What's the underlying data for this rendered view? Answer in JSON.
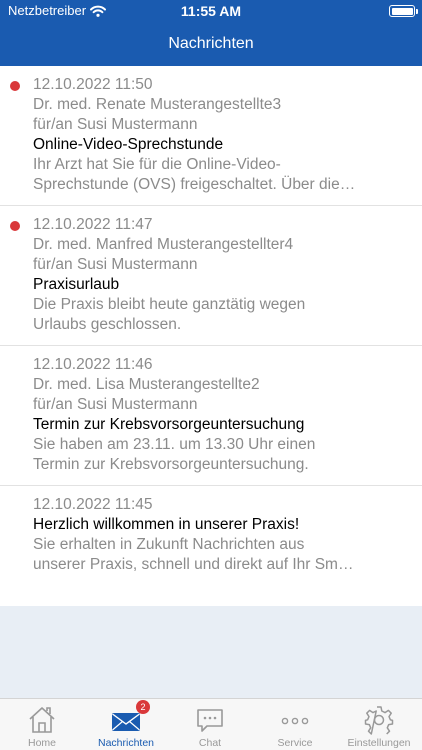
{
  "status_bar": {
    "carrier": "Netzbetreiber",
    "time": "11:55 AM"
  },
  "nav": {
    "title": "Nachrichten"
  },
  "messages": [
    {
      "unread": true,
      "datetime": "12.10.2022 11:50",
      "sender": "Dr. med. Renate Musterangestellte3",
      "recipient": "für/an Susi Mustermann",
      "subject": "Online-Video-Sprechstunde",
      "preview_1": "Ihr Arzt hat Sie für die Online-Video-",
      "preview_2": "Sprechstunde (OVS) freigeschaltet. Über die…"
    },
    {
      "unread": true,
      "datetime": "12.10.2022 11:47",
      "sender": "Dr. med. Manfred Musterangestellter4",
      "recipient": "für/an Susi Mustermann",
      "subject": "Praxisurlaub",
      "preview_1": "Die Praxis bleibt heute ganztätig wegen",
      "preview_2": "Urlaubs geschlossen."
    },
    {
      "unread": false,
      "datetime": "12.10.2022 11:46",
      "sender": "Dr. med. Lisa Musterangestellte2",
      "recipient": "für/an Susi Mustermann",
      "subject": "Termin zur Krebsvorsorgeuntersuchung",
      "preview_1": "Sie haben am 23.11. um 13.30 Uhr einen",
      "preview_2": "Termin zur Krebsvorsorgeuntersuchung."
    },
    {
      "unread": false,
      "datetime": "12.10.2022 11:45",
      "subject": "Herzlich willkommen in unserer Praxis!",
      "preview_1": "Sie erhalten in Zukunft Nachrichten aus",
      "preview_2": "unserer Praxis, schnell und direkt auf Ihr Sm…"
    }
  ],
  "tabbar": {
    "home": "Home",
    "messages": "Nachrichten",
    "messages_badge": "2",
    "chat": "Chat",
    "service": "Service",
    "settings": "Einstellungen"
  },
  "colors": {
    "brand": "#1a5bb0",
    "unread": "#d9383a",
    "inactive": "#999999"
  }
}
